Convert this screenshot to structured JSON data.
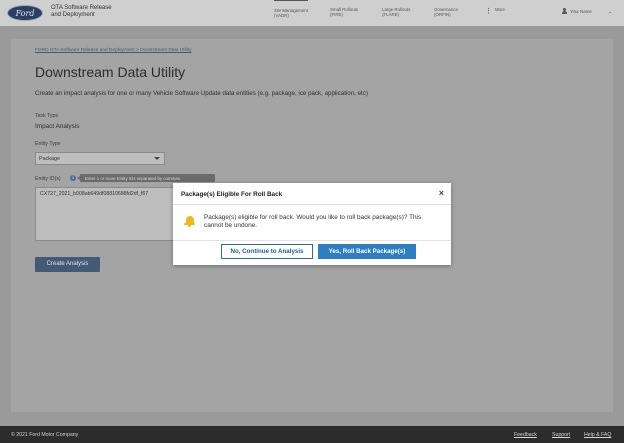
{
  "header": {
    "logo_text": "Ford",
    "app_title_line1": "OTA Software Release",
    "app_title_line2": "and Deployment",
    "nav": [
      {
        "line1": "SW Management",
        "line2": "(VADR)"
      },
      {
        "line1": "Small Rollouts",
        "line2": "(FIRE)"
      },
      {
        "line1": "Large Rollouts",
        "line2": "(FLARE)"
      },
      {
        "line1": "Governance",
        "line2": "(ORFIN)"
      }
    ],
    "more_label": "More",
    "user_label": "Your Name"
  },
  "main": {
    "breadcrumb": "FORD OTA Software Release and Deployment > Downstream Data Utility",
    "title": "Downstream Data Utility",
    "description": "Create an impact analysis for one or many Vehicle Software Update data entities (e.g. package, ice pack, application, etc)",
    "task_type_label": "Task Type",
    "task_type_value": "Impact Analysis",
    "entity_type_label": "Entity Type",
    "entity_type_selected": "Package",
    "entity_ids_label": "Entity ID(s)",
    "entity_ids_tooltip": "Enter 1 or more Entity IDs separated by commas.",
    "entity_ids_value": "CX727_2021_b008ab649df08810688fd2df_f67",
    "create_button": "Create Analysis"
  },
  "modal": {
    "title": "Package(s) Eligible For Roll Back",
    "close_glyph": "×",
    "message": "Package(s) eligible for roll back. Would you like to roll back package(s)? This cannot be undone.",
    "secondary_button": "No, Continue to Analysis",
    "primary_button": "Yes, Roll Back Package(s)"
  },
  "footer": {
    "copyright": "© 2021 Ford Motor Company",
    "links": [
      "Feedback",
      "Support",
      "Help & FAQ"
    ]
  },
  "colors": {
    "primary": "#2d7fc1",
    "warning_bell": "#f2b818",
    "footer_bg": "#2c2c2c"
  }
}
